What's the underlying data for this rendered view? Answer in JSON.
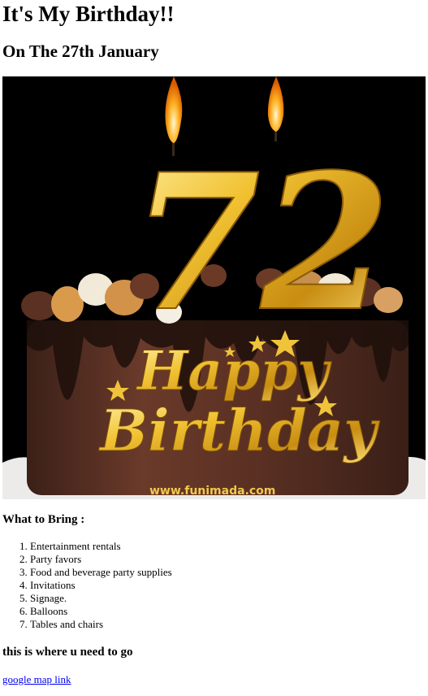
{
  "page": {
    "title": "It's My Birthday!!",
    "subtitle": "On The 27th January"
  },
  "hero": {
    "candle_number": "72",
    "greeting_line1": "Happy",
    "greeting_line2": "Birthday",
    "watermark": "www.funimada.com"
  },
  "bring": {
    "heading": "What to Bring :",
    "items": [
      {
        "label": "Entertainment rentals"
      },
      {
        "label": "Party favors"
      },
      {
        "label": "Food and beverage party supplies"
      },
      {
        "label": "Invitations"
      },
      {
        "label": "Signage."
      },
      {
        "label": "Balloons"
      },
      {
        "label": "Tables and chairs"
      }
    ]
  },
  "location": {
    "heading": "this is where u need to go",
    "link_label": "google map link"
  },
  "colors": {
    "link": "#0000ee",
    "gold": "#e8b32a",
    "chocolate": "#4a2a1e",
    "background_dark": "#000000"
  }
}
